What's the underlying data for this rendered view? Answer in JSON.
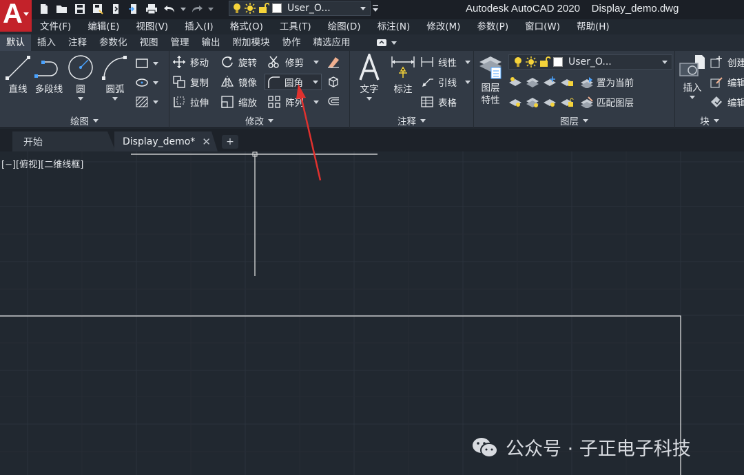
{
  "app": {
    "title": "Autodesk AutoCAD 2020    Display_demo.dwg",
    "logo_letter": "A",
    "layer_combo_value": "User_O..."
  },
  "menu": [
    "文件(F)",
    "编辑(E)",
    "视图(V)",
    "插入(I)",
    "格式(O)",
    "工具(T)",
    "绘图(D)",
    "标注(N)",
    "修改(M)",
    "参数(P)",
    "窗口(W)",
    "帮助(H)"
  ],
  "ribbon_tabs": [
    "默认",
    "插入",
    "注释",
    "参数化",
    "视图",
    "管理",
    "输出",
    "附加模块",
    "协作",
    "精选应用"
  ],
  "ribbon": {
    "draw": {
      "title": "绘图",
      "line": "直线",
      "polyline": "多段线",
      "circle": "圆",
      "arc": "圆弧"
    },
    "modify": {
      "title": "修改",
      "move": "移动",
      "rotate": "旋转",
      "trim": "修剪",
      "copy": "复制",
      "mirror": "镜像",
      "fillet": "圆角",
      "stretch": "拉伸",
      "scale": "缩放",
      "array": "阵列"
    },
    "annotation": {
      "title": "注释",
      "text": "文字",
      "dimension": "标注",
      "linear": "线性",
      "leader": "引线",
      "table": "表格"
    },
    "layers": {
      "title": "图层",
      "properties_line1": "图层",
      "properties_line2": "特性",
      "layer_value": "User_O...",
      "set_current": "置为当前",
      "match_layer": "匹配图层"
    },
    "block": {
      "title": "块",
      "insert": "插入",
      "create": "创建",
      "edit1": "编辑",
      "edit2": "编辑"
    }
  },
  "doc_tabs": {
    "start": "开始",
    "active": "Display_demo*",
    "close": "✕",
    "add": "+"
  },
  "viewport": {
    "label": "[−][俯视][二维线框]"
  },
  "watermark": "公众号 · 子正电子科技",
  "colors": {
    "background": "#212830",
    "ribbon": "#323a45",
    "accent_red": "#c3222a",
    "arrow_red": "#e0312e",
    "grid": "#2a313a",
    "geometry": "#e8e8e8"
  }
}
